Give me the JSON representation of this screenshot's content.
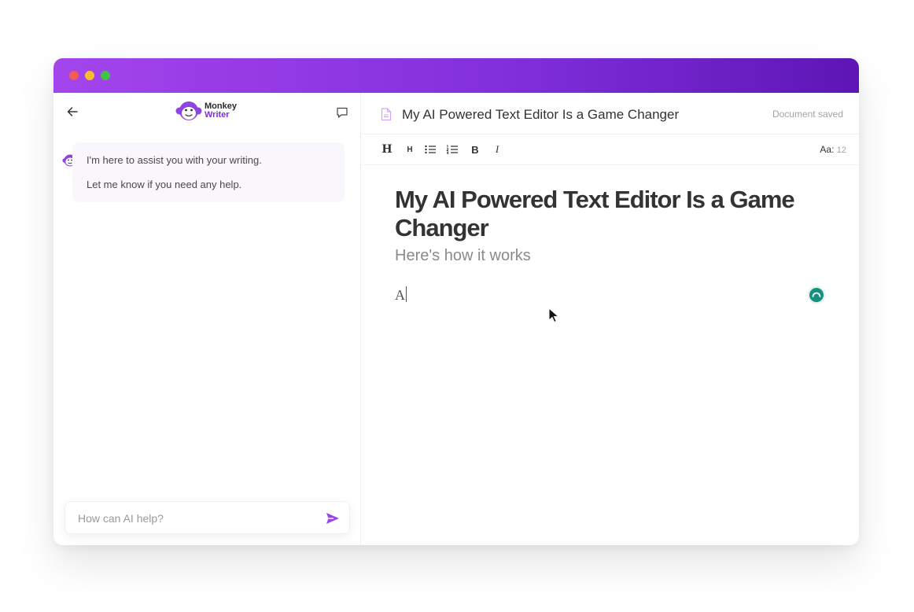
{
  "app": {
    "name_line1": "Monkey",
    "name_line2": "Writer",
    "accent_color": "#8230dc"
  },
  "sidebar": {
    "back_icon": "arrow-left-icon",
    "chat_icon": "chat-bubble-icon",
    "messages": [
      {
        "line1": "I'm here to assist you with your writing.",
        "line2": "Let me know if you need any help."
      }
    ],
    "input_placeholder": "How can AI help?",
    "send_icon": "send-icon"
  },
  "document": {
    "header_title": "My AI Powered Text Editor Is a Game Changer",
    "status": "Document saved",
    "toolbar": {
      "h1": "H",
      "h2": "H",
      "bold": "B",
      "italic": "I",
      "font_label": "Aa",
      "font_size": "12"
    },
    "title": "My AI Powered Text Editor Is a Game Changer",
    "subtitle": "Here's how it works",
    "body": "A"
  }
}
